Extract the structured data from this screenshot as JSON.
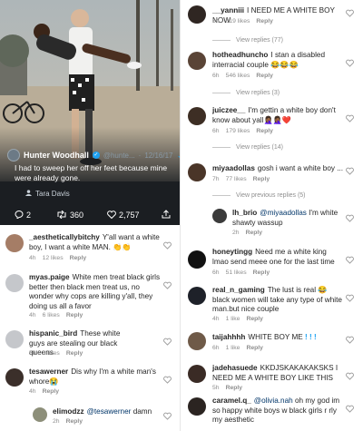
{
  "tweet": {
    "author_name": "Hunter Woodhall",
    "handle": "@hunte...",
    "date": "12/16/17",
    "text": "I had to sweep her off her feet because mine were already gone.",
    "tagged": "Tara Davis",
    "replies": "2",
    "retweets": "360",
    "likes": "2,757"
  },
  "left_comments": [
    {
      "username": "_aestheticallybitchy",
      "text": "Y'all want a white boy, I want a white MAN.",
      "time": "4h",
      "likes": "12 likes",
      "reply": "Reply"
    },
    {
      "username": "myas.paige",
      "text": "White men treat black girls better then black men treat us, no wonder why cops are killing y'all, they doing us all a favor",
      "time": "4h",
      "likes": "6 likes",
      "reply": "Reply"
    },
    {
      "username": "hispanic_bird",
      "text": "These white guys are stealing our black queens",
      "time": "5h",
      "likes": "3 likes",
      "reply": "Reply"
    },
    {
      "username": "tesawerner",
      "text": "Dis why I'm a white man's whore",
      "time": "4h",
      "likes": "",
      "reply": "Reply"
    },
    {
      "username": "elimodzz",
      "mention": "@tesawerner",
      "text": "damn",
      "time": "2h",
      "likes": "",
      "reply": "Reply"
    }
  ],
  "right_comments": [
    {
      "username": "__yanniii",
      "text": "I NEED ME A WHITE BOY NOW",
      "time": "6h",
      "likes": "619 likes",
      "reply": "Reply",
      "view_replies": "View replies (77)"
    },
    {
      "username": "hotheadhuncho",
      "text": "I stan a disabled interracial couple",
      "time": "6h",
      "likes": "546 likes",
      "reply": "Reply",
      "view_replies": "View replies (3)"
    },
    {
      "username": "juiczee__",
      "text": "I'm gettin a white boy don't know about yall",
      "time": "6h",
      "likes": "179 likes",
      "reply": "Reply",
      "view_replies": "View replies (14)"
    },
    {
      "username": "miyaadollas",
      "text": "gosh i want a white boy ...",
      "time": "7h",
      "likes": "77 likes",
      "reply": "Reply",
      "view_replies": "View previous replies (5)"
    },
    {
      "username": "lh_brio",
      "mention": "@miyaadollas",
      "text": "I'm white shawty wassup",
      "time": "2h",
      "likes": "",
      "reply": "Reply"
    },
    {
      "username": "honeytingg",
      "text": "Need me a white king lmao send meee one for the last time",
      "time": "6h",
      "likes": "51 likes",
      "reply": "Reply"
    },
    {
      "username": "real_n_gaming",
      "text": "The lust is real 😂 black women will take any type of white man.but nice couple",
      "time": "4h",
      "likes": "1 like",
      "reply": "Reply"
    },
    {
      "username": "taijahhhh",
      "text": "WHITE BOY ME",
      "time": "6h",
      "likes": "1 like",
      "reply": "Reply"
    },
    {
      "username": "jadehasuede",
      "text": "KKDJSKAKAKAKSKS I NEED ME A WHITE BOY LIKE THIS",
      "time": "5h",
      "likes": "",
      "reply": "Reply"
    },
    {
      "username": "caramel.q_",
      "mention": "@olivia.nah",
      "text": "oh my god im so happy white boys w black girls r rly my aesthetic",
      "time": "",
      "likes": "",
      "reply": ""
    }
  ]
}
